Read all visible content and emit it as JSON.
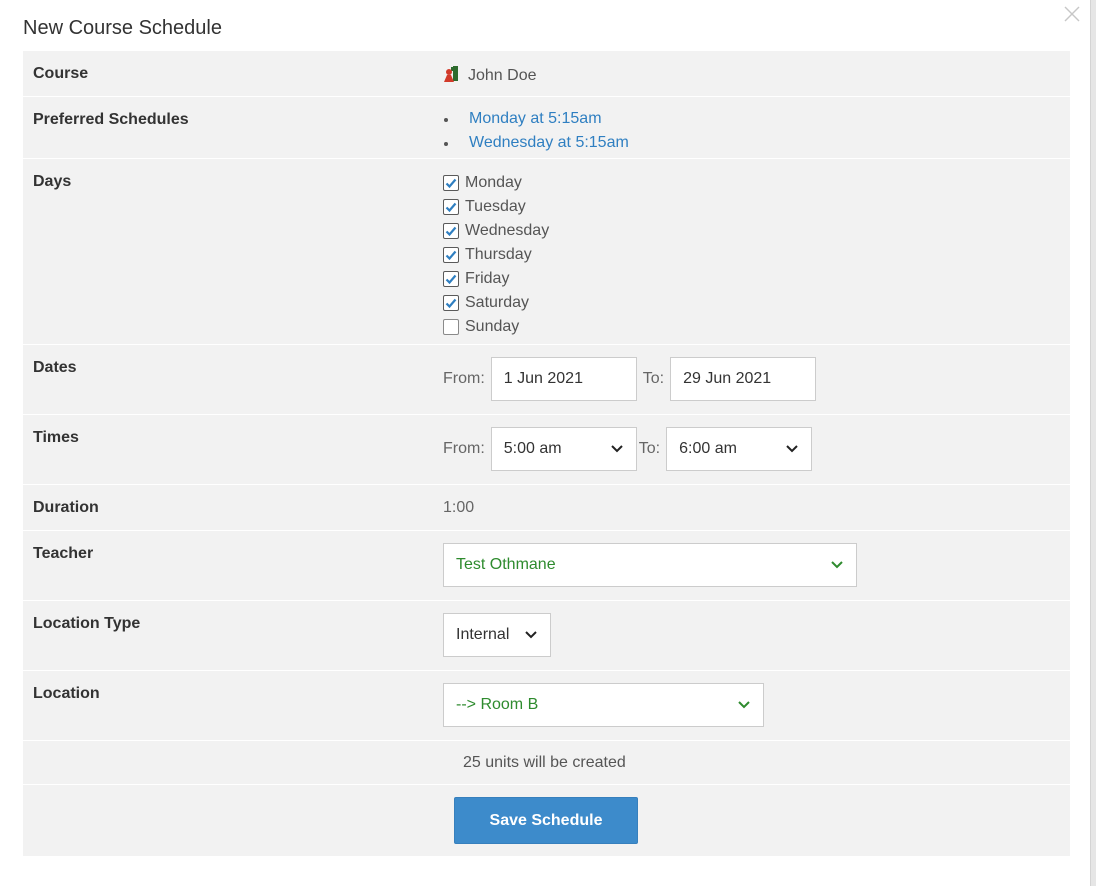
{
  "modal": {
    "title": "New Course Schedule",
    "close_icon": "close-icon"
  },
  "form": {
    "course": {
      "label": "Course",
      "value": "John Doe",
      "icon": "course-icon"
    },
    "preferred": {
      "label": "Preferred Schedules",
      "items": [
        "Monday at 5:15am",
        "Wednesday at 5:15am"
      ]
    },
    "days": {
      "label": "Days",
      "items": [
        {
          "name": "Monday",
          "checked": true
        },
        {
          "name": "Tuesday",
          "checked": true
        },
        {
          "name": "Wednesday",
          "checked": true
        },
        {
          "name": "Thursday",
          "checked": true
        },
        {
          "name": "Friday",
          "checked": true
        },
        {
          "name": "Saturday",
          "checked": true
        },
        {
          "name": "Sunday",
          "checked": false
        }
      ]
    },
    "dates": {
      "label": "Dates",
      "from_label": "From:",
      "from": "1 Jun 2021",
      "to_label": "To:",
      "to": "29 Jun 2021"
    },
    "times": {
      "label": "Times",
      "from_label": "From:",
      "from": "5:00 am",
      "to_label": "To:",
      "to": "6:00 am"
    },
    "duration": {
      "label": "Duration",
      "value": "1:00"
    },
    "teacher": {
      "label": "Teacher",
      "value": "Test Othmane"
    },
    "location_type": {
      "label": "Location Type",
      "value": "Internal"
    },
    "location": {
      "label": "Location",
      "value": "--> Room B"
    },
    "units_message": "25 units will be created",
    "save_label": "Save Schedule"
  },
  "colors": {
    "link": "#2f7fc1",
    "accent_green": "#2e8b2e",
    "button": "#3d8bcb",
    "row_bg": "#f2f2f2",
    "check": "#2f7fc1"
  }
}
